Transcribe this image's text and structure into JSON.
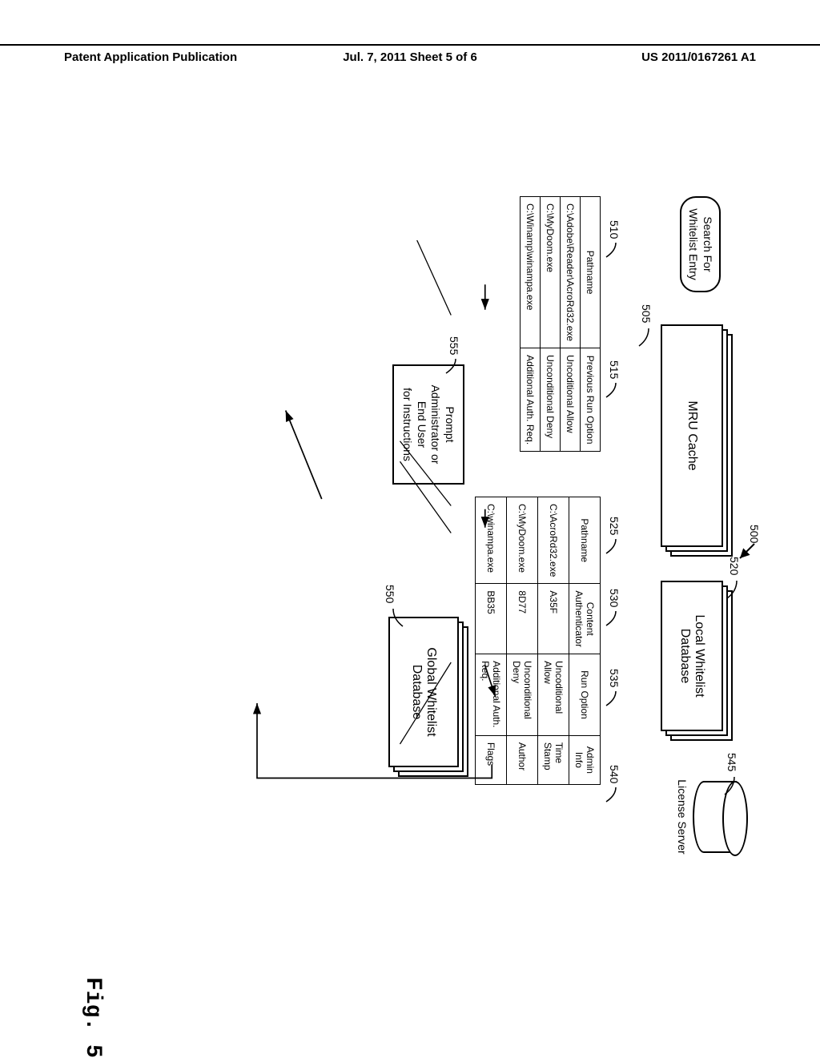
{
  "header": {
    "left": "Patent Application Publication",
    "center": "Jul. 7, 2011  Sheet 5 of 6",
    "right": "US 2011/0167261 A1"
  },
  "figure_label": "Fig. 5",
  "refs": {
    "r500": "500",
    "r505": "505",
    "r510": "510",
    "r515": "515",
    "r520": "520",
    "r525": "525",
    "r530": "530",
    "r535": "535",
    "r540": "540",
    "r545": "545",
    "r550": "550",
    "r555": "555"
  },
  "blocks": {
    "search_entry": "Search For\nWhitelist Entry",
    "mru_cache": "MRU Cache",
    "local_db": "Local Whitelist\nDatabase",
    "license_server": "License Server",
    "global_db": "Global Whitelist\nDatabase",
    "prompt_box": "Prompt\nAdministrator or\nEnd User\nfor Instructions"
  },
  "mru_table": {
    "headers": [
      "Pathname",
      "Previous Run Option"
    ],
    "rows": [
      [
        "C:\\Adobe\\Reader\\AcroRd32.exe",
        "Uncoditional Allow"
      ],
      [
        "C:\\MyDoom.exe",
        "Unconditional Deny"
      ],
      [
        "C:\\Winamp\\winampa.exe",
        "Additional Auth. Req."
      ]
    ]
  },
  "local_table": {
    "headers": [
      "Pathname",
      "Content\nAuthenticator",
      "Run Option",
      "Admin Info"
    ],
    "rows": [
      [
        "C:\\AcroRd32.exe",
        "A35F",
        "Uncoditional Allow",
        "Time Stamp"
      ],
      [
        "C:\\MyDoom.exe",
        "8D77",
        "Unconditional Deny",
        "Author"
      ],
      [
        "C:\\winampa.exe",
        "BB35",
        "Additional Auth. Req.",
        "Flags"
      ]
    ]
  }
}
